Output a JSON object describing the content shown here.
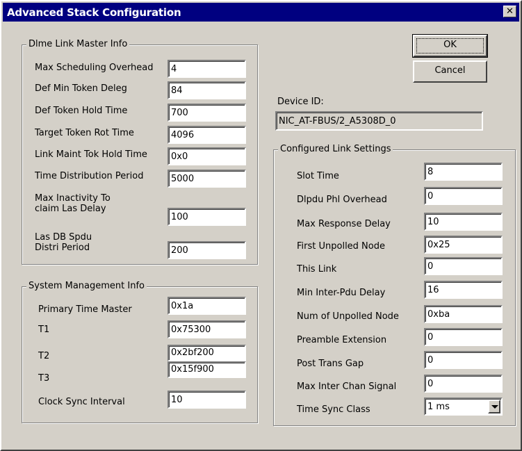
{
  "window": {
    "title": "Advanced Stack Configuration",
    "close_glyph": "✕"
  },
  "buttons": {
    "ok": "OK",
    "cancel": "Cancel"
  },
  "device": {
    "label": "Device ID:",
    "value": "NIC_AT-FBUS/2_A5308D_0"
  },
  "dlme": {
    "legend": "Dlme Link Master Info",
    "fields": [
      {
        "label": "Max Scheduling Overhead",
        "value": "4"
      },
      {
        "label": "Def Min Token Deleg",
        "value": "84"
      },
      {
        "label": "Def Token Hold Time",
        "value": "700"
      },
      {
        "label": "Target Token Rot Time",
        "value": "4096"
      },
      {
        "label": "Link Maint Tok Hold Time",
        "value": "0x0"
      },
      {
        "label": "Time Distribution Period",
        "value": "5000"
      },
      {
        "label1": "Max Inactivity To",
        "label2": "claim Las Delay",
        "value": "100"
      },
      {
        "label1": "Las DB Spdu",
        "label2": "Distri Period",
        "value": "200"
      }
    ]
  },
  "sysmgmt": {
    "legend": "System Management Info",
    "fields": [
      {
        "label": "Primary Time Master",
        "value": "0x1a"
      },
      {
        "label": "T1",
        "value": "0x75300"
      },
      {
        "label": "T2",
        "value": "0x2bf200"
      },
      {
        "label": "T3",
        "value": "0x15f900"
      },
      {
        "label": "Clock Sync Interval",
        "value": "10"
      }
    ]
  },
  "link": {
    "legend": "Configured Link Settings",
    "fields": [
      {
        "label": "Slot Time",
        "value": "8"
      },
      {
        "label": "Dlpdu Phl Overhead",
        "value": "0"
      },
      {
        "label": "Max Response Delay",
        "value": "10"
      },
      {
        "label": "First Unpolled Node",
        "value": "0x25"
      },
      {
        "label": "This Link",
        "value": "0"
      },
      {
        "label": "Min Inter-Pdu Delay",
        "value": "16"
      },
      {
        "label": "Num of Unpolled Node",
        "value": "0xba"
      },
      {
        "label": "Preamble Extension",
        "value": "0"
      },
      {
        "label": "Post Trans Gap",
        "value": "0"
      },
      {
        "label": "Max Inter Chan Signal",
        "value": "0"
      },
      {
        "label": "Time Sync Class",
        "value": "1 ms"
      }
    ]
  }
}
